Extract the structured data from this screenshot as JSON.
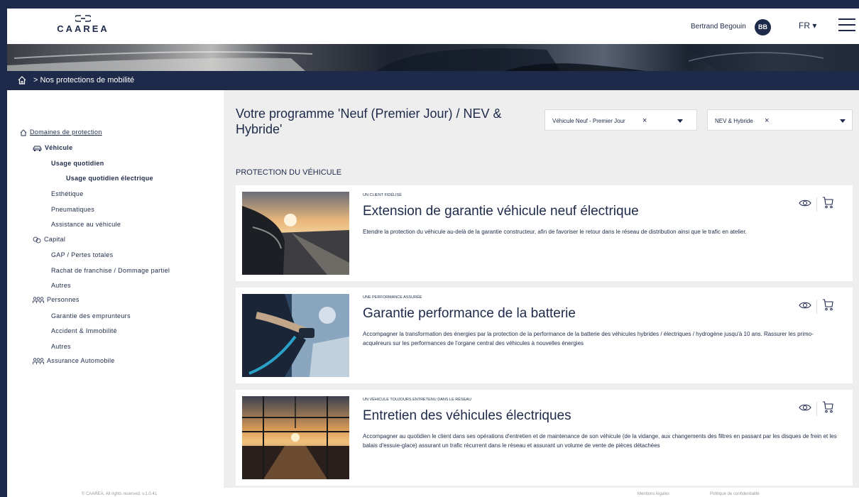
{
  "header": {
    "logo_text": "CAAREA",
    "user_name": "Bertrand Begouin",
    "user_initials": "BB",
    "language": "FR ▾"
  },
  "breadcrumb": {
    "text": "> Nos protections de mobilité"
  },
  "sidebar": {
    "root": "Domaines de protection",
    "items": [
      {
        "label": "Véhicule"
      },
      {
        "label": "Usage quotidien"
      },
      {
        "label": "Usage quotidien électrique"
      },
      {
        "label": "Esthétique"
      },
      {
        "label": "Pneumatiques"
      },
      {
        "label": "Assistance au véhicule"
      },
      {
        "label": "Capital"
      },
      {
        "label": "GAP / Pertes totales"
      },
      {
        "label": "Rachat de franchise / Dommage partiel"
      },
      {
        "label": "Autres"
      },
      {
        "label": "Personnes"
      },
      {
        "label": "Garantie des emprunteurs"
      },
      {
        "label": "Accident & Immobilité"
      },
      {
        "label": "Autres"
      },
      {
        "label": "Assurance Automobile"
      }
    ]
  },
  "main": {
    "title": "Votre programme 'Neuf (Premier Jour) / NEV & Hybride'",
    "filters": [
      {
        "value": "Véhicule Neuf - Premier Jour",
        "clear": "×"
      },
      {
        "value": "NEV & Hybride",
        "clear": "×"
      }
    ],
    "section_title": "PROTECTION DU VÉHICULE",
    "cards": [
      {
        "eyebrow": "Un client fidélisé",
        "title": "Extension de garantie véhicule neuf électrique",
        "description": "Etendre la protection du véhicule au-delà de la garantie constructeur, afin de favoriser le retour dans le réseau de distribution ainsi que le trafic en atelier."
      },
      {
        "eyebrow": "Une performance assurée",
        "title": "Garantie performance de la batterie",
        "description": "Accompagner la transformation des énergies par la protection de la performance de la batterie des véhicules hybrides / électriques / hydrogène jusqu'à 10 ans. Rassurer les primo-acquéreurs sur les performances de l'organe central des véhicules à nouvelles énergies"
      },
      {
        "eyebrow": "Un véhicule toujours entretenu dans le réseau",
        "title": "Entretien des véhicules électriques",
        "description": "Accompagner au quotidien le client dans ses opérations d'entretien et de maintenance de son véhicule (de la vidange, aux changements des filtres en passant par les disques de frein et les balais d'essuie-glace) assurant un trafic récurrent dans le réseau et assurant un volume de vente de pièces détachées"
      }
    ]
  },
  "footer": {
    "copyright": "© CAAREA. All rights reserved. v.1.0.41",
    "links": [
      "Mentions légales",
      "Politique de confidentialité"
    ]
  },
  "colors": {
    "navy": "#1e2a49",
    "panel": "#eeeeee"
  }
}
